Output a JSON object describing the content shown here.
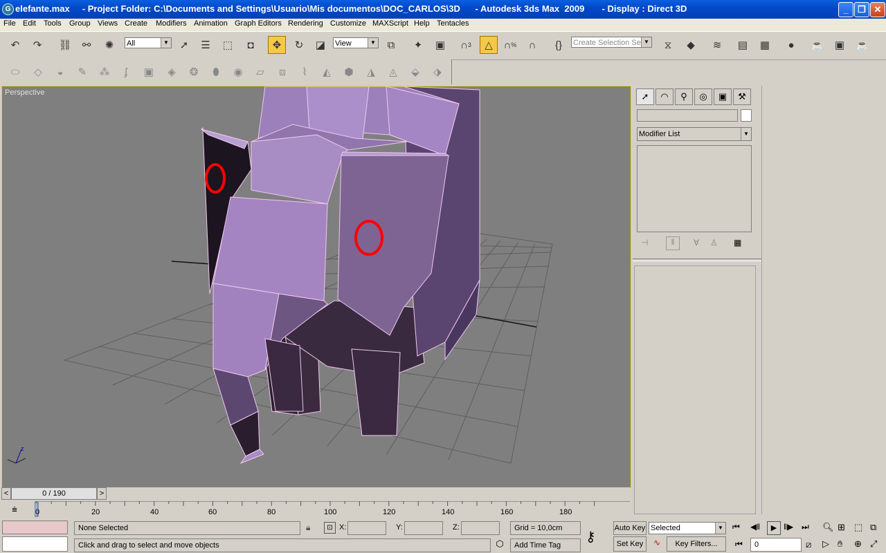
{
  "window": {
    "title": "elefante.max     - Project Folder: C:\\Documents and Settings\\Usuario\\Mis documentos\\DOC_CARLOS\\3D      - Autodesk 3ds Max  2009       - Display : Direct 3D",
    "app_icon": "3ds-max-icon",
    "minimize_icon": "minimize-icon",
    "restore_icon": "restore-icon",
    "close_icon": "close-icon"
  },
  "menu": {
    "items": [
      "File",
      "Edit",
      "Tools",
      "Group",
      "Views",
      "Create",
      "Modifiers",
      "Animation",
      "Graph Editors",
      "Rendering",
      "Customize",
      "MAXScript",
      "Help",
      "Tentacles"
    ]
  },
  "toolbar": {
    "selection_filter": "All",
    "reference_coord": "View",
    "named_selection_placeholder": "Create Selection Set",
    "snap_label": "3",
    "percent_snap_label": "%"
  },
  "viewport": {
    "label": "Perspective",
    "axis_label": "z"
  },
  "command_panel": {
    "modifier_list": "Modifier List",
    "name_field": ""
  },
  "timeline": {
    "frame_counter": "0 / 190",
    "ticks": [
      "0",
      "20",
      "40",
      "60",
      "80",
      "100",
      "120",
      "140",
      "160",
      "180"
    ]
  },
  "status": {
    "selection_status": "None Selected",
    "prompt": "Click and drag to select and move objects",
    "x_label": "X:",
    "y_label": "Y:",
    "z_label": "Z:",
    "grid": "Grid = 10,0cm",
    "add_time_tag": "Add Time Tag",
    "auto_key": "Auto Key",
    "set_key": "Set Key",
    "key_mode": "Selected",
    "key_filters": "Key Filters...",
    "current_frame": "0"
  },
  "colors": {
    "title_bar": "#0449c8",
    "viewport_bg": "#7f7f7f",
    "viewport_border": "#e6d800",
    "mesh_color": "#a88cc4",
    "annotation": "#ff0000",
    "swatch": "#e8c8c8"
  }
}
